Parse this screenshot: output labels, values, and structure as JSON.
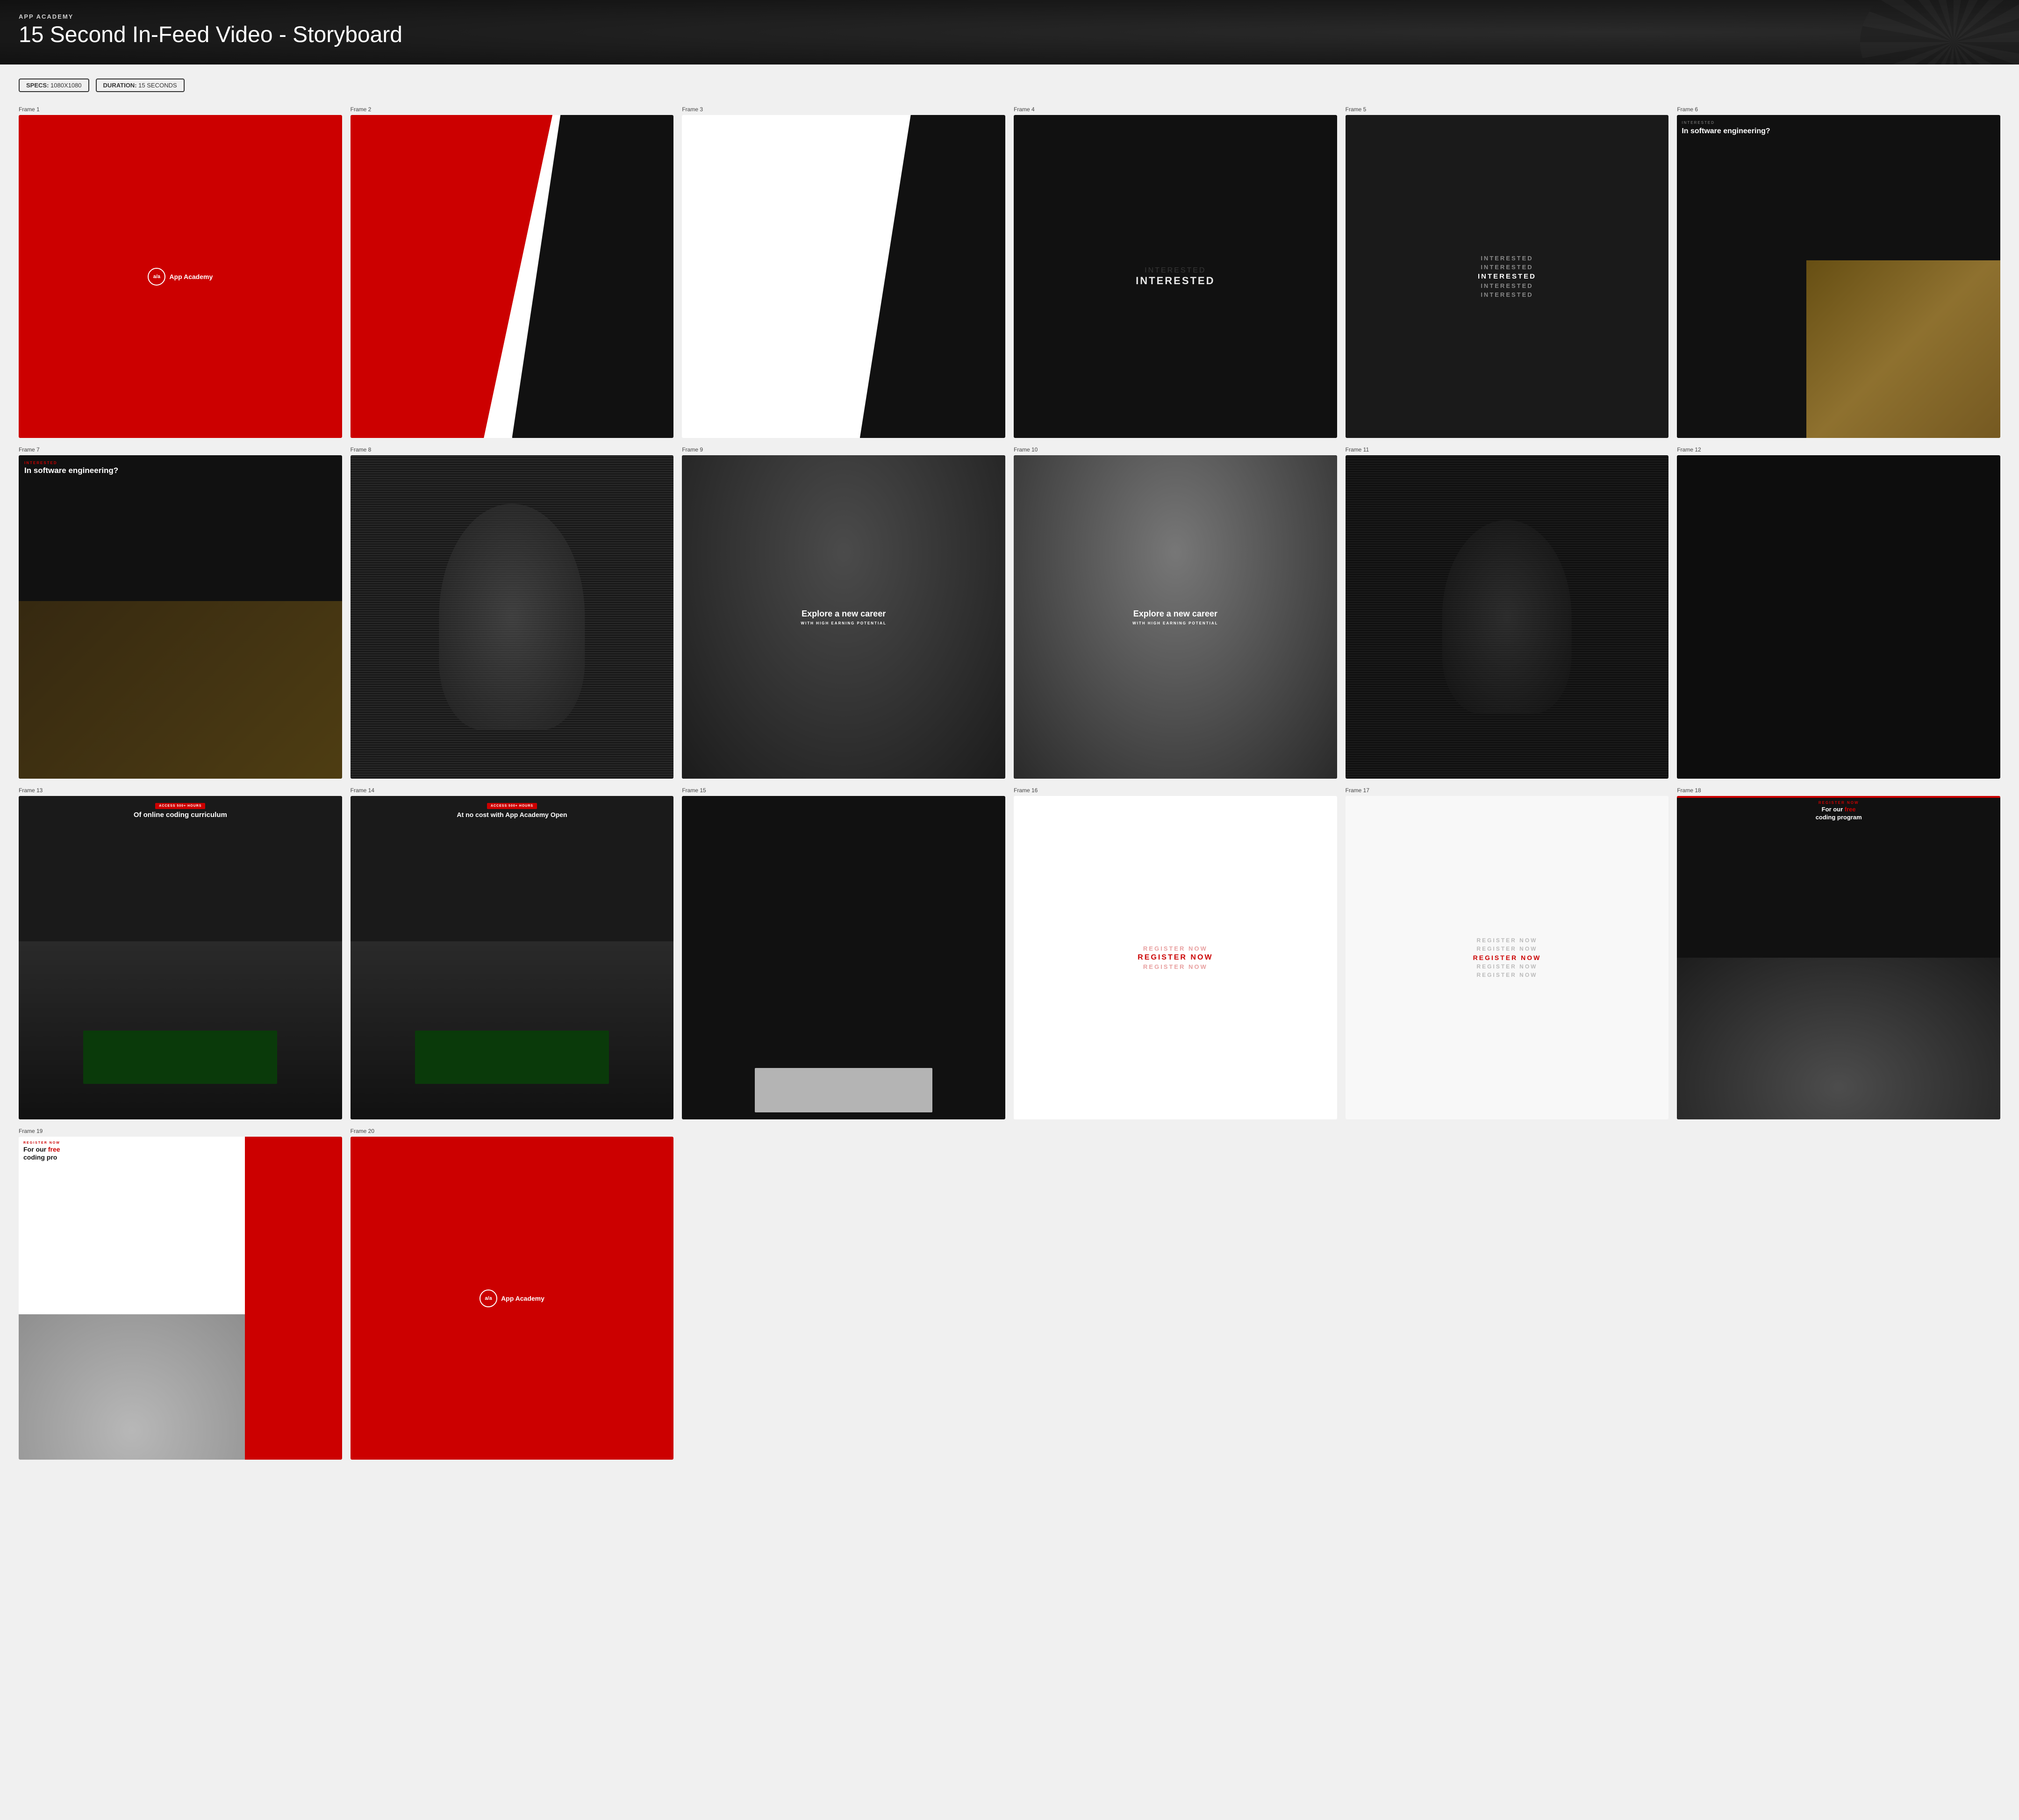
{
  "header": {
    "brand": "APP ACADEMY",
    "title_bold": "15 Second In-Feed Video",
    "title_light": " - Storyboard"
  },
  "specs": {
    "specs_label": "SPECS:",
    "specs_value": "1080X1080",
    "duration_label": "DURATION:",
    "duration_value": "15 SECONDS"
  },
  "frames": [
    {
      "id": "Frame 1",
      "desc": "App Academy logo on red background"
    },
    {
      "id": "Frame 2",
      "desc": "Red and black diagonal split"
    },
    {
      "id": "Frame 3",
      "desc": "White and black diagonal split"
    },
    {
      "id": "Frame 4",
      "desc": "INTERESTED text on dark background"
    },
    {
      "id": "Frame 5",
      "desc": "INTERESTED repeated text"
    },
    {
      "id": "Frame 6",
      "desc": "Interested in software engineering with person"
    },
    {
      "id": "Frame 7",
      "desc": "In software engineering dark overlay"
    },
    {
      "id": "Frame 8",
      "desc": "Wave pattern with silhouette"
    },
    {
      "id": "Frame 9",
      "desc": "Explore a new career with high earning potential"
    },
    {
      "id": "Frame 10",
      "desc": "Explore a new career brighter"
    },
    {
      "id": "Frame 11",
      "desc": "Wave pattern darker"
    },
    {
      "id": "Frame 12",
      "desc": "Nearly black frame"
    },
    {
      "id": "Frame 13",
      "desc": "Access 500+ hours of online coding curriculum"
    },
    {
      "id": "Frame 14",
      "desc": "Access 500+ hours at no cost with App Academy Open"
    },
    {
      "id": "Frame 15",
      "desc": "Dark with white box at bottom"
    },
    {
      "id": "Frame 16",
      "desc": "Register Now fading in"
    },
    {
      "id": "Frame 17",
      "desc": "Register Now repeated text"
    },
    {
      "id": "Frame 18",
      "desc": "Register Now for our free coding program"
    },
    {
      "id": "Frame 19",
      "desc": "Register Now for our free coding program with red stripe"
    },
    {
      "id": "Frame 20",
      "desc": "App Academy logo on red background final"
    }
  ],
  "frame_labels": {
    "f1": "Frame 1",
    "f2": "Frame 2",
    "f3": "Frame 3",
    "f4": "Frame 4",
    "f5": "Frame 5",
    "f6": "Frame 6",
    "f7": "Frame 7",
    "f8": "Frame 8",
    "f9": "Frame 9",
    "f10": "Frame 10",
    "f11": "Frame 11",
    "f12": "Frame 12",
    "f13": "Frame 13",
    "f14": "Frame 14",
    "f15": "Frame 15",
    "f16": "Frame 16",
    "f17": "Frame 17",
    "f18": "Frame 18",
    "f19": "Frame 19",
    "f20": "Frame 20"
  },
  "text": {
    "interested": "INTERESTED",
    "in_software": "In software engineering?",
    "explore": "Explore a new career",
    "high_earning": "WITH HIGH EARNING POTENTIAL",
    "access_badge": "ACCESS 500+ HOURS",
    "coding_curriculum": "Of online coding curriculum",
    "no_cost": "At no cost with App Academy Open",
    "register_now": "REGISTER NOW",
    "free_program": "For our free coding program",
    "app_academy": "App Academy",
    "logo_text": "a/a"
  }
}
